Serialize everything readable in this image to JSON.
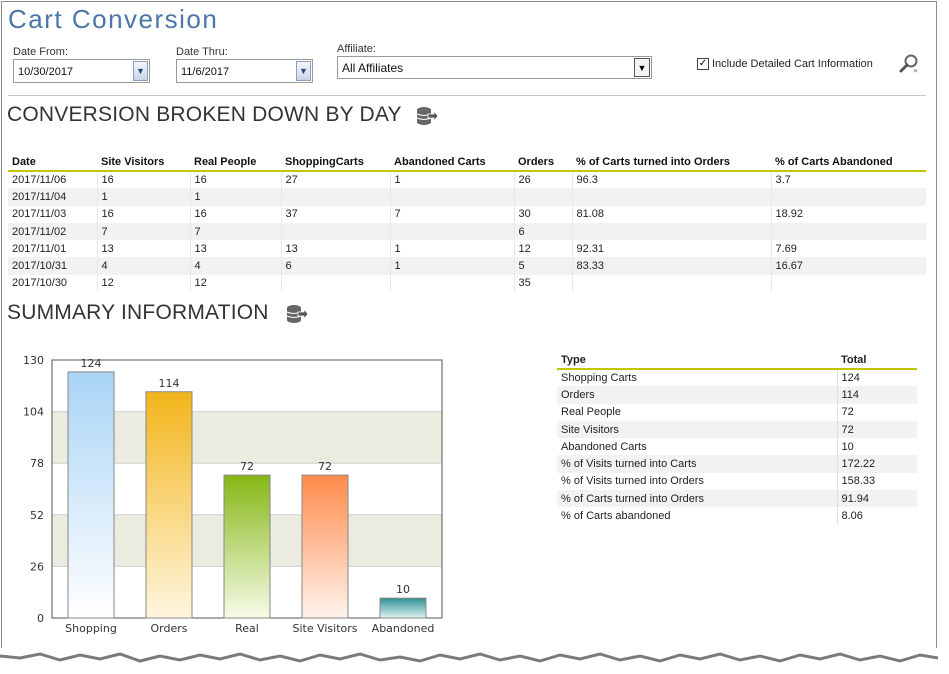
{
  "page": {
    "title": "Cart Conversion"
  },
  "filters": {
    "date_from_label": "Date From:",
    "date_from_value": "10/30/2017",
    "date_thru_label": "Date Thru:",
    "date_thru_value": "11/6/2017",
    "affiliate_label": "Affiliate:",
    "affiliate_value": "All Affiliates",
    "include_detail_label": "Include Detailed Cart Information",
    "include_detail_checked": true
  },
  "sections": {
    "by_day_title": "CONVERSION BROKEN DOWN BY DAY",
    "summary_title": "SUMMARY INFORMATION"
  },
  "day_table": {
    "headers": [
      "Date",
      "Site Visitors",
      "Real People",
      "ShoppingCarts",
      "Abandoned Carts",
      "Orders",
      "% of Carts turned into Orders",
      "% of Carts Abandoned"
    ],
    "rows": [
      [
        "2017/11/06",
        "16",
        "16",
        "27",
        "1",
        "26",
        "96.3",
        "3.7"
      ],
      [
        "2017/11/04",
        "1",
        "1",
        "",
        "",
        "",
        "",
        ""
      ],
      [
        "2017/11/03",
        "16",
        "16",
        "37",
        "7",
        "30",
        "81.08",
        "18.92"
      ],
      [
        "2017/11/02",
        "7",
        "7",
        "",
        "",
        "6",
        "",
        ""
      ],
      [
        "2017/11/01",
        "13",
        "13",
        "13",
        "1",
        "12",
        "92.31",
        "7.69"
      ],
      [
        "2017/10/31",
        "4",
        "4",
        "6",
        "1",
        "5",
        "83.33",
        "16.67"
      ],
      [
        "2017/10/30",
        "12",
        "12",
        "",
        "",
        "35",
        "",
        ""
      ]
    ]
  },
  "summary_table": {
    "headers": [
      "Type",
      "Total"
    ],
    "rows": [
      [
        "Shopping Carts",
        "124"
      ],
      [
        "Orders",
        "114"
      ],
      [
        "Real People",
        "72"
      ],
      [
        "Site Visitors",
        "72"
      ],
      [
        "Abandoned Carts",
        "10"
      ],
      [
        "% of Visits turned into Carts",
        "172.22"
      ],
      [
        "% of Visits turned into Orders",
        "158.33"
      ],
      [
        "% of Carts turned into Orders",
        "91.94"
      ],
      [
        "% of Carts abandoned",
        "8.06"
      ]
    ]
  },
  "chart_data": {
    "type": "bar",
    "categories": [
      "Shopping",
      "Orders",
      "Real",
      "Site Visitors",
      "Abandoned"
    ],
    "values": [
      124,
      114,
      72,
      72,
      10
    ],
    "yticks": [
      0,
      26,
      52,
      78,
      104,
      130
    ],
    "ylim": [
      0,
      130
    ],
    "grid": true,
    "colors": [
      [
        "#a9d4f5",
        "#ffffff"
      ],
      [
        "#f2b51a",
        "#fff6df"
      ],
      [
        "#86b715",
        "#f6fbe8"
      ],
      [
        "#ff8a4a",
        "#fff3ec"
      ],
      [
        "#2f8f93",
        "#dff3f3"
      ]
    ],
    "band_color": "#ebebdf"
  }
}
